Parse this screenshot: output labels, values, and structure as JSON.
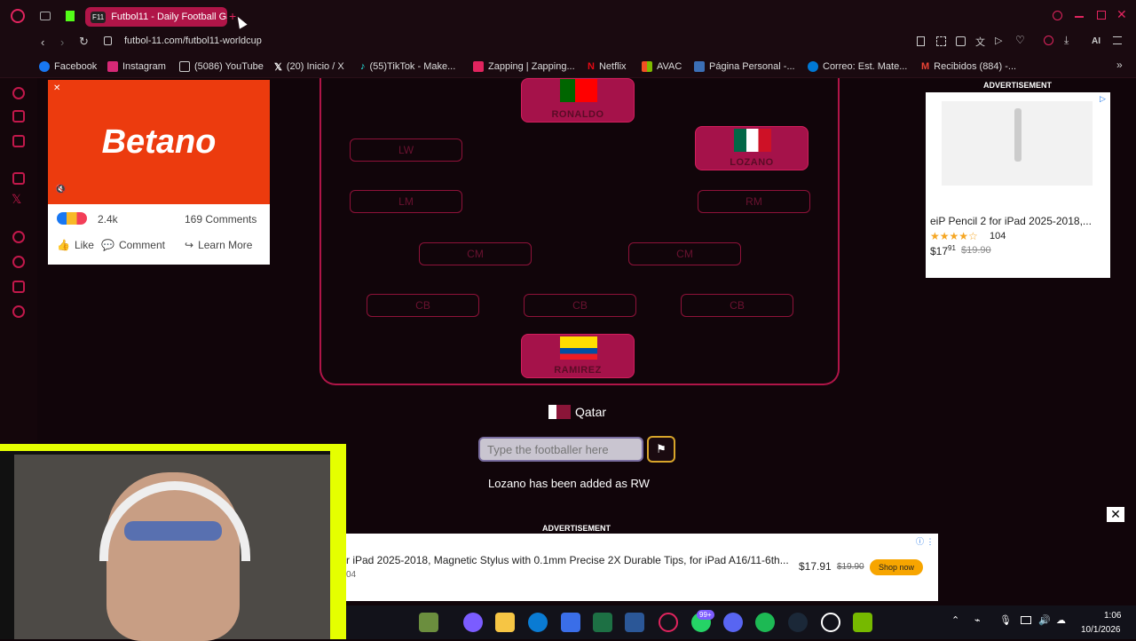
{
  "browser": {
    "tab_title": "Futbol11 - Daily Football Ga",
    "tab_icon": "F11",
    "url": "futbol-11.com/futbol11-worldcup",
    "ai_label": "AI"
  },
  "bookmarks": [
    {
      "label": "Facebook",
      "color": "#1877f2"
    },
    {
      "label": "Instagram",
      "color": "#d62976"
    },
    {
      "label": "(5086) YouTube",
      "color": "#888888"
    },
    {
      "label": "(20) Inicio / X",
      "color": "#ffffff"
    },
    {
      "label": "(55)TikTok - Make...",
      "color": "#25f4ee"
    },
    {
      "label": "Zapping | Zapping...",
      "color": "#e0245e"
    },
    {
      "label": "Netflix",
      "color": "#e50914"
    },
    {
      "label": "AVAC",
      "color": "#f25022"
    },
    {
      "label": "Página Personal -...",
      "color": "#3b6fb6"
    },
    {
      "label": "Correo: Est. Mate...",
      "color": "#0078d4"
    },
    {
      "label": "Recibidos (884) -...",
      "color": "#ea4335"
    }
  ],
  "field": {
    "positions": {
      "lw": "LW",
      "lm": "LM",
      "rm": "RM",
      "cm1": "CM",
      "cm2": "CM",
      "cb1": "CB",
      "cb2": "CB",
      "cb3": "CB"
    },
    "players": {
      "top": "RONALDO",
      "rw": "LOZANO",
      "gk": "RAMIREZ"
    }
  },
  "game": {
    "country": "Qatar",
    "input_placeholder": "Type the footballer here",
    "message": "Lozano has been added as RW"
  },
  "fb_ad": {
    "brand": "Betano",
    "reactions": "2.4k",
    "comments": "169 Comments",
    "like": "Like",
    "comment": "Comment",
    "learn_more": "Learn More"
  },
  "right_ad": {
    "label": "ADVERTISEMENT",
    "title": "eiP Pencil 2 for iPad 2025-2018,...",
    "rating": "104",
    "price_main": "$17",
    "price_cents": "91",
    "price_old": "$19.90"
  },
  "bottom_ad": {
    "label": "ADVERTISEMENT",
    "text": "r iPad 2025-2018, Magnetic Stylus with 0.1mm Precise 2X Durable Tips, for iPad A16/11-6th...",
    "subtext": "04",
    "price": "$17.91",
    "price_old": "$19.90",
    "cta": "Shop now"
  },
  "taskbar": {
    "badge": "99+",
    "time": "1:06",
    "date": "10/1/2026"
  }
}
